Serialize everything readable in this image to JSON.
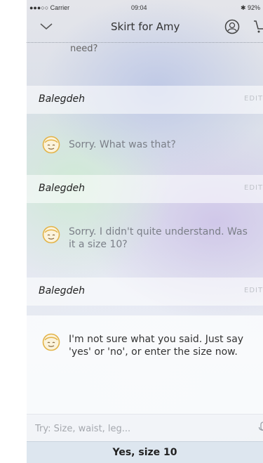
{
  "status": {
    "signal": "●●●○○ Carrier",
    "time": "09:04",
    "battery": "92%"
  },
  "header": {
    "title": "Skirt for Amy"
  },
  "conversation": {
    "trail_text": "need?",
    "user_name": "Balegdeh",
    "edit_label": "EDIT",
    "messages": [
      {
        "text": "Sorry. What was that?"
      },
      {
        "text": "Sorry. I didn't quite understand. Was it a size 10?"
      },
      {
        "text": "I'm not sure what you said. Just say 'yes' or 'no', or enter the size now."
      }
    ]
  },
  "input": {
    "placeholder": "Try: Size, waist, leg..."
  },
  "suggestion": {
    "label": "Yes, size 10"
  }
}
